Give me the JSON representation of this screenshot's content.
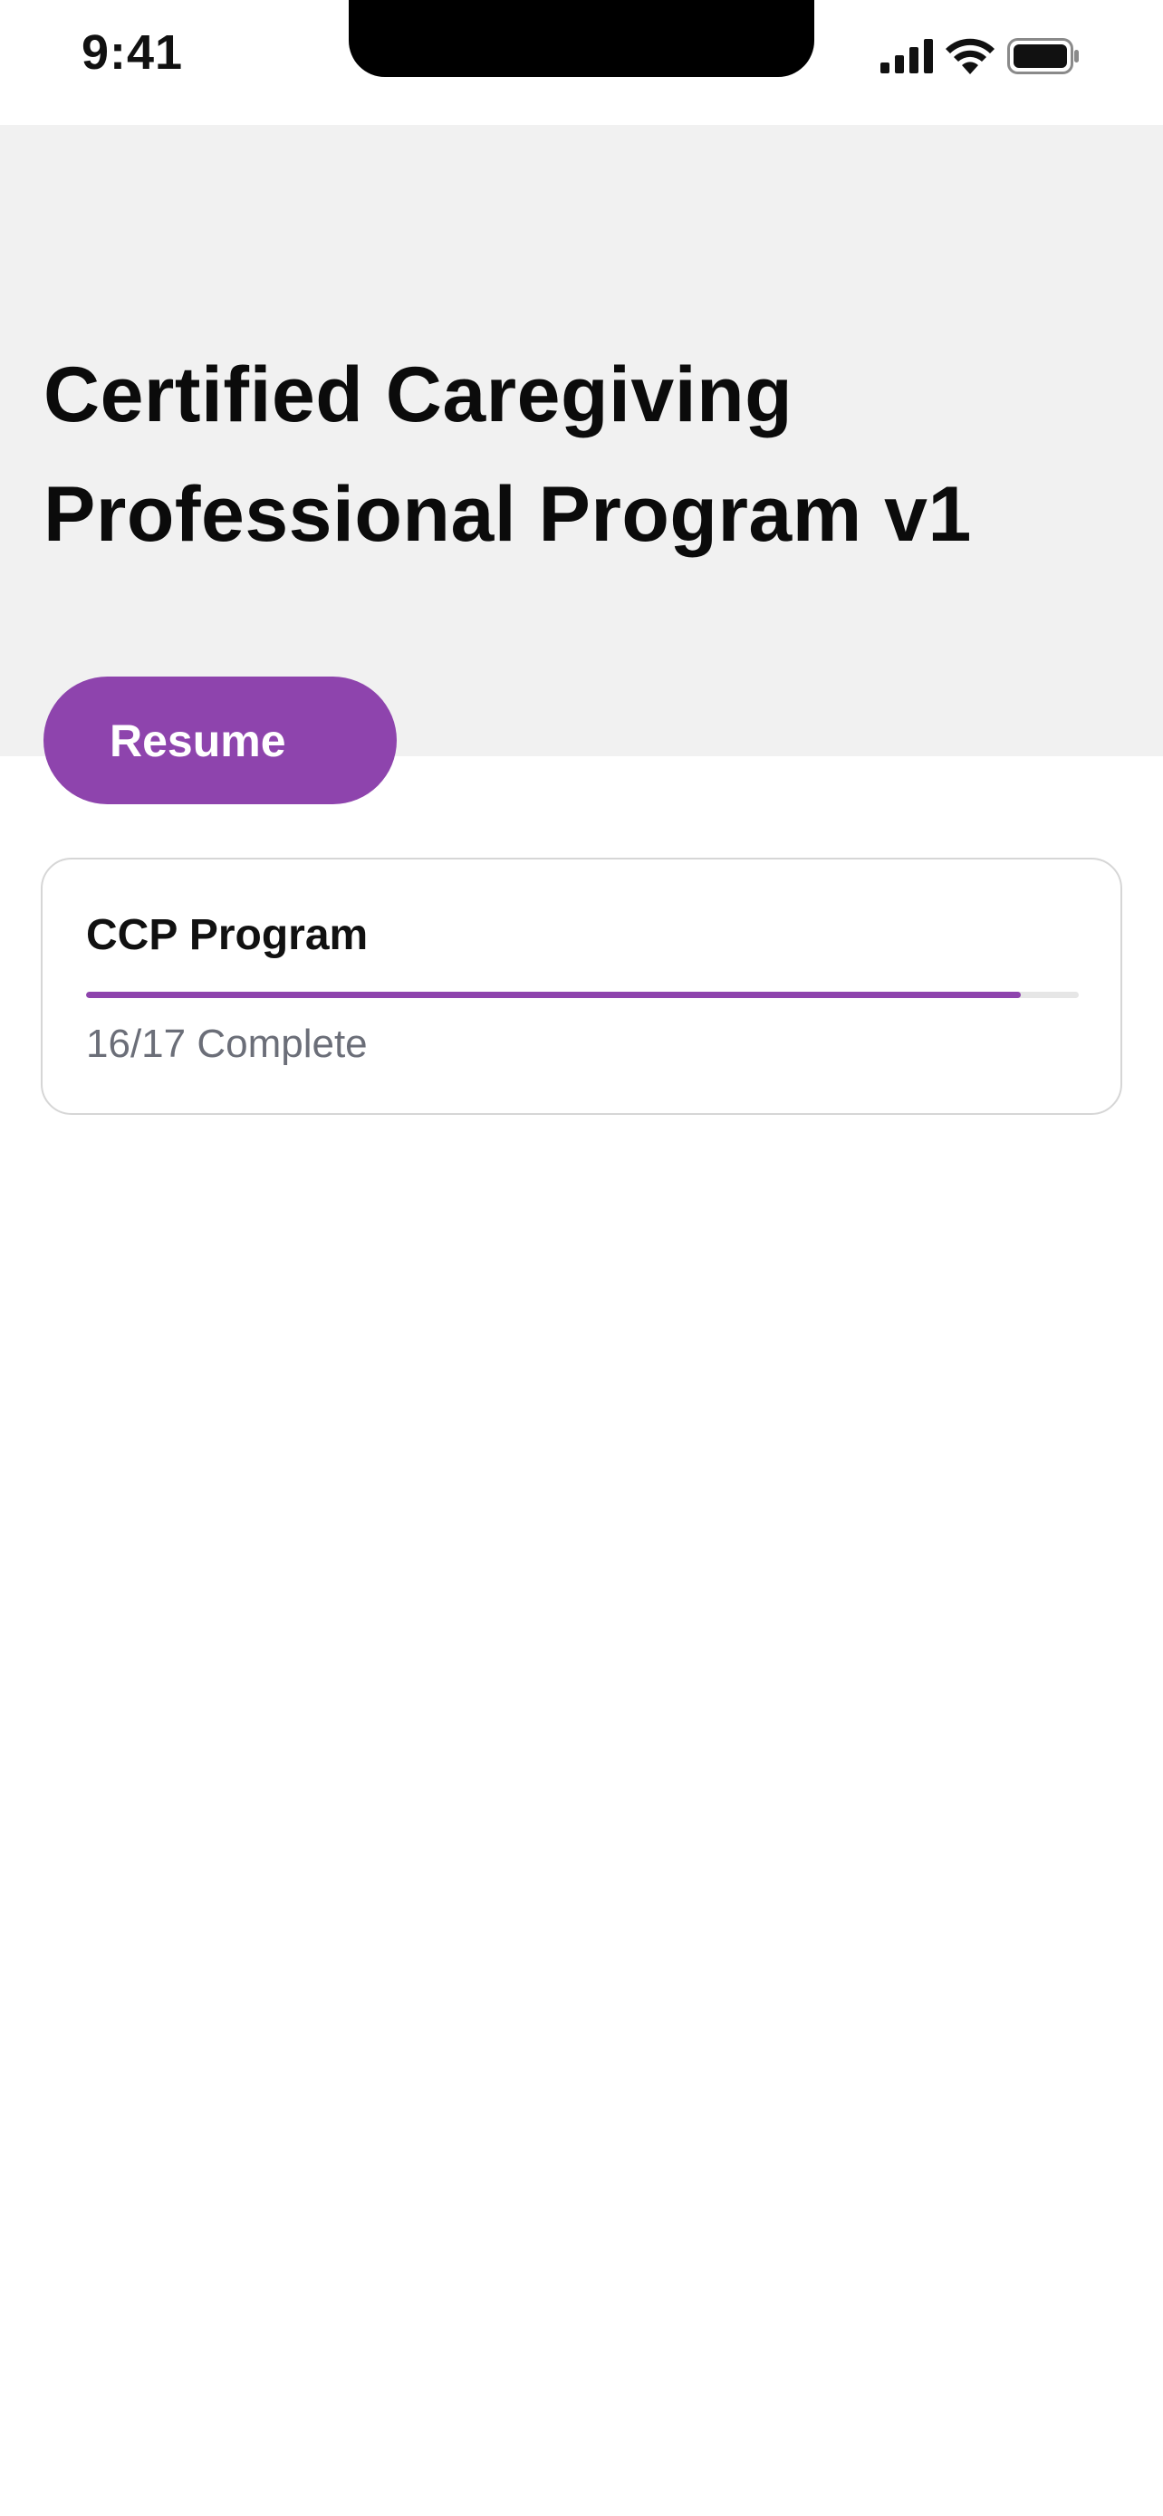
{
  "status_bar": {
    "time": "9:41",
    "icons": [
      "cellular-signal-icon",
      "wifi-icon",
      "battery-icon"
    ]
  },
  "header": {
    "title_lines": [
      "Certified Caregiving",
      "Professional Program v1"
    ]
  },
  "actions": {
    "resume_label": "Resume"
  },
  "program_card": {
    "title": "CCP Program",
    "completed": 16,
    "total": 17,
    "status_text": "16/17 Complete"
  },
  "colors": {
    "accent": "#8e44ad",
    "header_background": "#f1f1f1",
    "muted_text": "#6b6e78",
    "card_border": "#d6d6d6"
  }
}
